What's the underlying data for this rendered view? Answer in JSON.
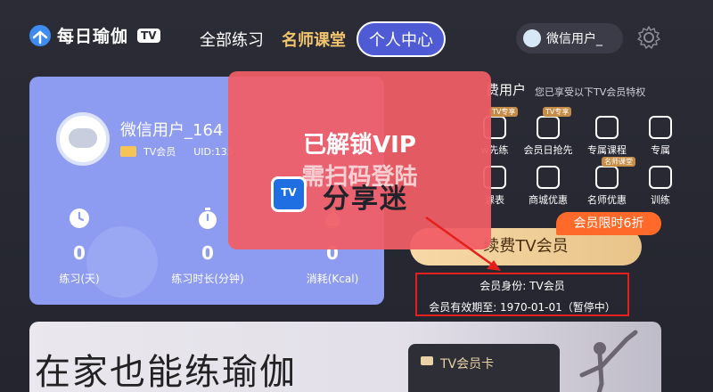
{
  "header": {
    "logo_text": "每日瑜伽",
    "logo_tv": "TV",
    "nav": [
      {
        "label": "全部练习"
      },
      {
        "label": "名师课堂"
      },
      {
        "label": "个人中心"
      }
    ],
    "user_pill": "微信用户_"
  },
  "user_card": {
    "name": "微信用户_164",
    "member_tag": "TV会员",
    "uid": "UID:135",
    "stats": [
      {
        "value": "0",
        "label": "练习(天)"
      },
      {
        "value": "0",
        "label": "练习时长(分钟)"
      },
      {
        "value": "0",
        "label": "消耗(Kcal)"
      }
    ]
  },
  "right_panel": {
    "title": "费用户",
    "subtitle": "您已享受以下TV会员特权",
    "perks": [
      {
        "label": "w先练",
        "tag": "TV专享"
      },
      {
        "label": "会员日抢先",
        "tag": "TV专享"
      },
      {
        "label": "专属课程",
        "tag": ""
      },
      {
        "label": "专属",
        "tag": ""
      },
      {
        "label": "课表",
        "tag": ""
      },
      {
        "label": "商城优惠",
        "tag": ""
      },
      {
        "label": "名师优惠",
        "tag": "名师课堂"
      },
      {
        "label": "训练",
        "tag": ""
      }
    ],
    "promo": "会员限时6折",
    "renew": "续费TV会员",
    "membership_identity": "会员身份: TV会员",
    "membership_expiry": "会员有效期至: 1970-01-01（暂停中）"
  },
  "overlay": {
    "line1": "已解锁VIP",
    "line2": "需扫码登陆",
    "logo": "TV",
    "brand": "分享迷"
  },
  "banner": {
    "headline": "在家也能练瑜伽",
    "card_label": "TV会员卡"
  },
  "colors": {
    "background": "#2b2c36",
    "user_card": "#8d9bf1",
    "nav_active": "#4f5bd5",
    "gold": "#f2c46d",
    "overlay": "#f05e66",
    "promo": "#ff6a2a",
    "highlight_box": "#e3201c"
  }
}
